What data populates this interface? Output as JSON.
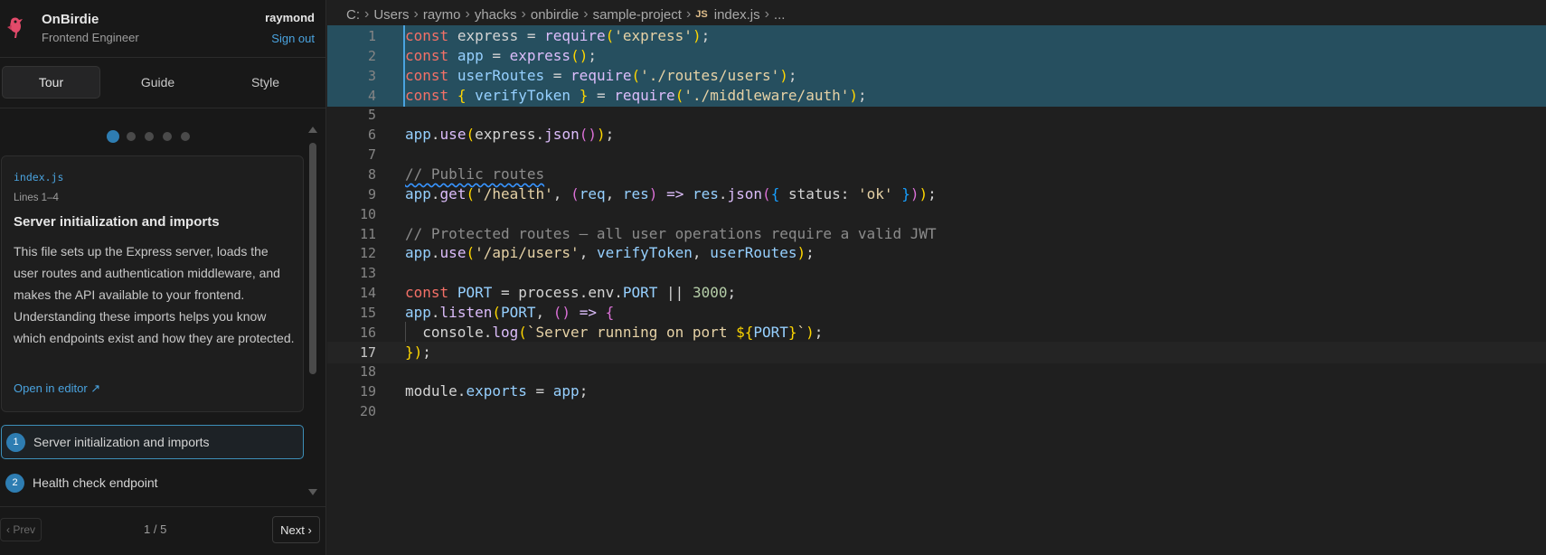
{
  "app": {
    "name": "OnBirdie",
    "role": "Frontend Engineer"
  },
  "user": {
    "name": "raymond",
    "sign_out": "Sign out"
  },
  "tabs": [
    {
      "label": "Tour",
      "active": true
    },
    {
      "label": "Guide",
      "active": false
    },
    {
      "label": "Style",
      "active": false
    }
  ],
  "tour": {
    "total_steps": 5,
    "current_step": 1,
    "card": {
      "file": "index.js",
      "lines": "Lines 1–4",
      "title": "Server initialization and imports",
      "description": "This file sets up the Express server, loads the user routes and authentication middleware, and makes the API available to your frontend. Understanding these imports helps you know which endpoints exist and how they are protected.",
      "open_link": "Open in editor ↗"
    },
    "steps": [
      {
        "num": "1",
        "label": "Server initialization and imports",
        "active": true
      },
      {
        "num": "2",
        "label": "Health check endpoint",
        "active": false
      }
    ],
    "footer": {
      "prev": "‹ Prev",
      "page": "1 / 5",
      "next": "Next ›"
    }
  },
  "breadcrumb": [
    "C:",
    "Users",
    "raymo",
    "yhacks",
    "onbirdie",
    "sample-project",
    "index.js",
    "..."
  ],
  "file_badge": "JS",
  "editor": {
    "highlight_lines": [
      1,
      2,
      3,
      4
    ],
    "cursor_line": 17,
    "lines": [
      "const express = require('express');",
      "const app = express();",
      "const userRoutes = require('./routes/users');",
      "const { verifyToken } = require('./middleware/auth');",
      "",
      "app.use(express.json());",
      "",
      "// Public routes",
      "app.get('/health', (req, res) => res.json({ status: 'ok' }));",
      "",
      "// Protected routes — all user operations require a valid JWT",
      "app.use('/api/users', verifyToken, userRoutes);",
      "",
      "const PORT = process.env.PORT || 3000;",
      "app.listen(PORT, () => {",
      "  console.log(`Server running on port ${PORT}`);",
      "});",
      "",
      "module.exports = app;",
      ""
    ]
  },
  "colors": {
    "accent": "#2e7db2",
    "link": "#4aa3df",
    "highlight": "#264f5f"
  }
}
